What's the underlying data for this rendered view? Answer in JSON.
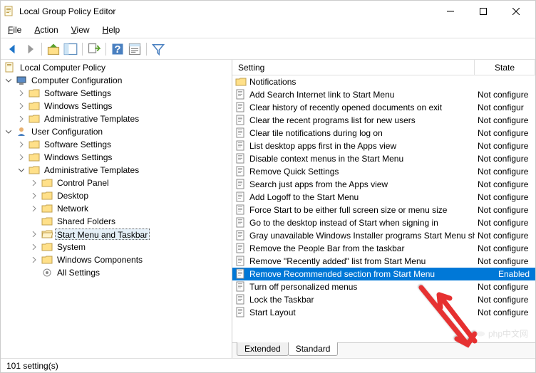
{
  "window": {
    "title": "Local Group Policy Editor"
  },
  "menu": {
    "file": "File",
    "action": "Action",
    "view": "View",
    "help": "Help"
  },
  "tree": {
    "root": "Local Computer Policy",
    "comp_config": "Computer Configuration",
    "comp_sw": "Software Settings",
    "comp_win": "Windows Settings",
    "comp_admin": "Administrative Templates",
    "user_config": "User Configuration",
    "user_sw": "Software Settings",
    "user_win": "Windows Settings",
    "user_admin": "Administrative Templates",
    "cp": "Control Panel",
    "desktop": "Desktop",
    "network": "Network",
    "shared": "Shared Folders",
    "start": "Start Menu and Taskbar",
    "system": "System",
    "wincomp": "Windows Components",
    "allset": "All Settings"
  },
  "columns": {
    "setting": "Setting",
    "state": "State"
  },
  "folder_row": "Notifications",
  "settings": [
    {
      "name": "Add Search Internet link to Start Menu",
      "state": "Not configure"
    },
    {
      "name": "Clear history of recently opened documents on exit",
      "state": "Not configur"
    },
    {
      "name": "Clear the recent programs list for new users",
      "state": "Not configure"
    },
    {
      "name": "Clear tile notifications during log on",
      "state": "Not configure"
    },
    {
      "name": "List desktop apps first in the Apps view",
      "state": "Not configure"
    },
    {
      "name": "Disable context menus in the Start Menu",
      "state": "Not configure"
    },
    {
      "name": "Remove Quick Settings",
      "state": "Not configure"
    },
    {
      "name": "Search just apps from the Apps view",
      "state": "Not configure"
    },
    {
      "name": "Add Logoff to the Start Menu",
      "state": "Not configure"
    },
    {
      "name": "Force Start to be either full screen size or menu size",
      "state": "Not configure"
    },
    {
      "name": "Go to the desktop instead of Start when signing in",
      "state": "Not configure"
    },
    {
      "name": "Gray unavailable Windows Installer programs Start Menu sh...",
      "state": "Not configure"
    },
    {
      "name": "Remove the People Bar from the taskbar",
      "state": "Not configure"
    },
    {
      "name": "Remove \"Recently added\" list from Start Menu",
      "state": "Not configure"
    },
    {
      "name": "Remove Recommended section from Start Menu",
      "state": "Enabled",
      "selected": true
    },
    {
      "name": "Turn off personalized menus",
      "state": "Not configure"
    },
    {
      "name": "Lock the Taskbar",
      "state": "Not configure"
    },
    {
      "name": "Start Layout",
      "state": "Not configure"
    }
  ],
  "tabs": {
    "extended": "Extended",
    "standard": "Standard"
  },
  "status": "101 setting(s)",
  "watermark": "php中文网"
}
